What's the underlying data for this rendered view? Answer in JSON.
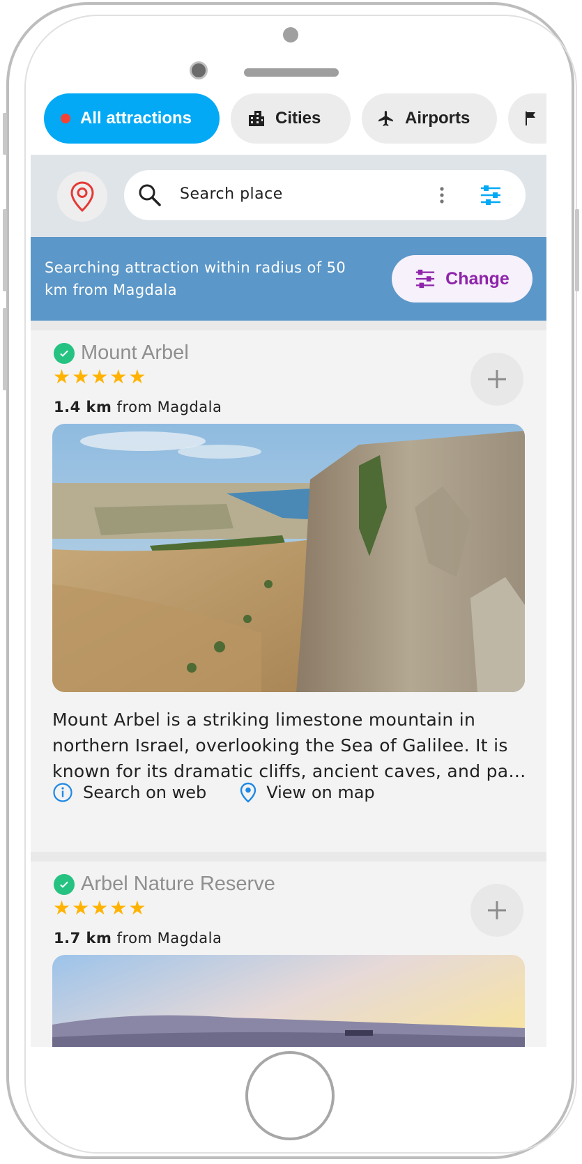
{
  "filter_chips": {
    "all": "All attractions",
    "cities": "Cities",
    "airports": "Airports"
  },
  "search": {
    "placeholder": "Search place"
  },
  "banner": {
    "text": "Searching attraction within radius of 50 km from Magdala",
    "change_label": "Change"
  },
  "attractions": [
    {
      "title": "Mount Arbel",
      "stars": "★★★★★",
      "distance": "1.4 km",
      "distance_suffix": " from Magdala",
      "description": "Mount Arbel is a striking limestone mountain in northern Israel, overlooking the Sea of Galilee. It is known for its dramatic cliffs, ancient caves, and pa…",
      "link_web": "Search on web",
      "link_map": "View on map"
    },
    {
      "title": "Arbel Nature Reserve",
      "stars": "★★★★★",
      "distance": "1.7 km",
      "distance_suffix": " from Magdala"
    }
  ],
  "colors": {
    "accent": "#03a9f4",
    "banner": "#5b97c8",
    "change_text": "#8e24aa",
    "verified": "#26c281",
    "star": "#ffb300"
  }
}
